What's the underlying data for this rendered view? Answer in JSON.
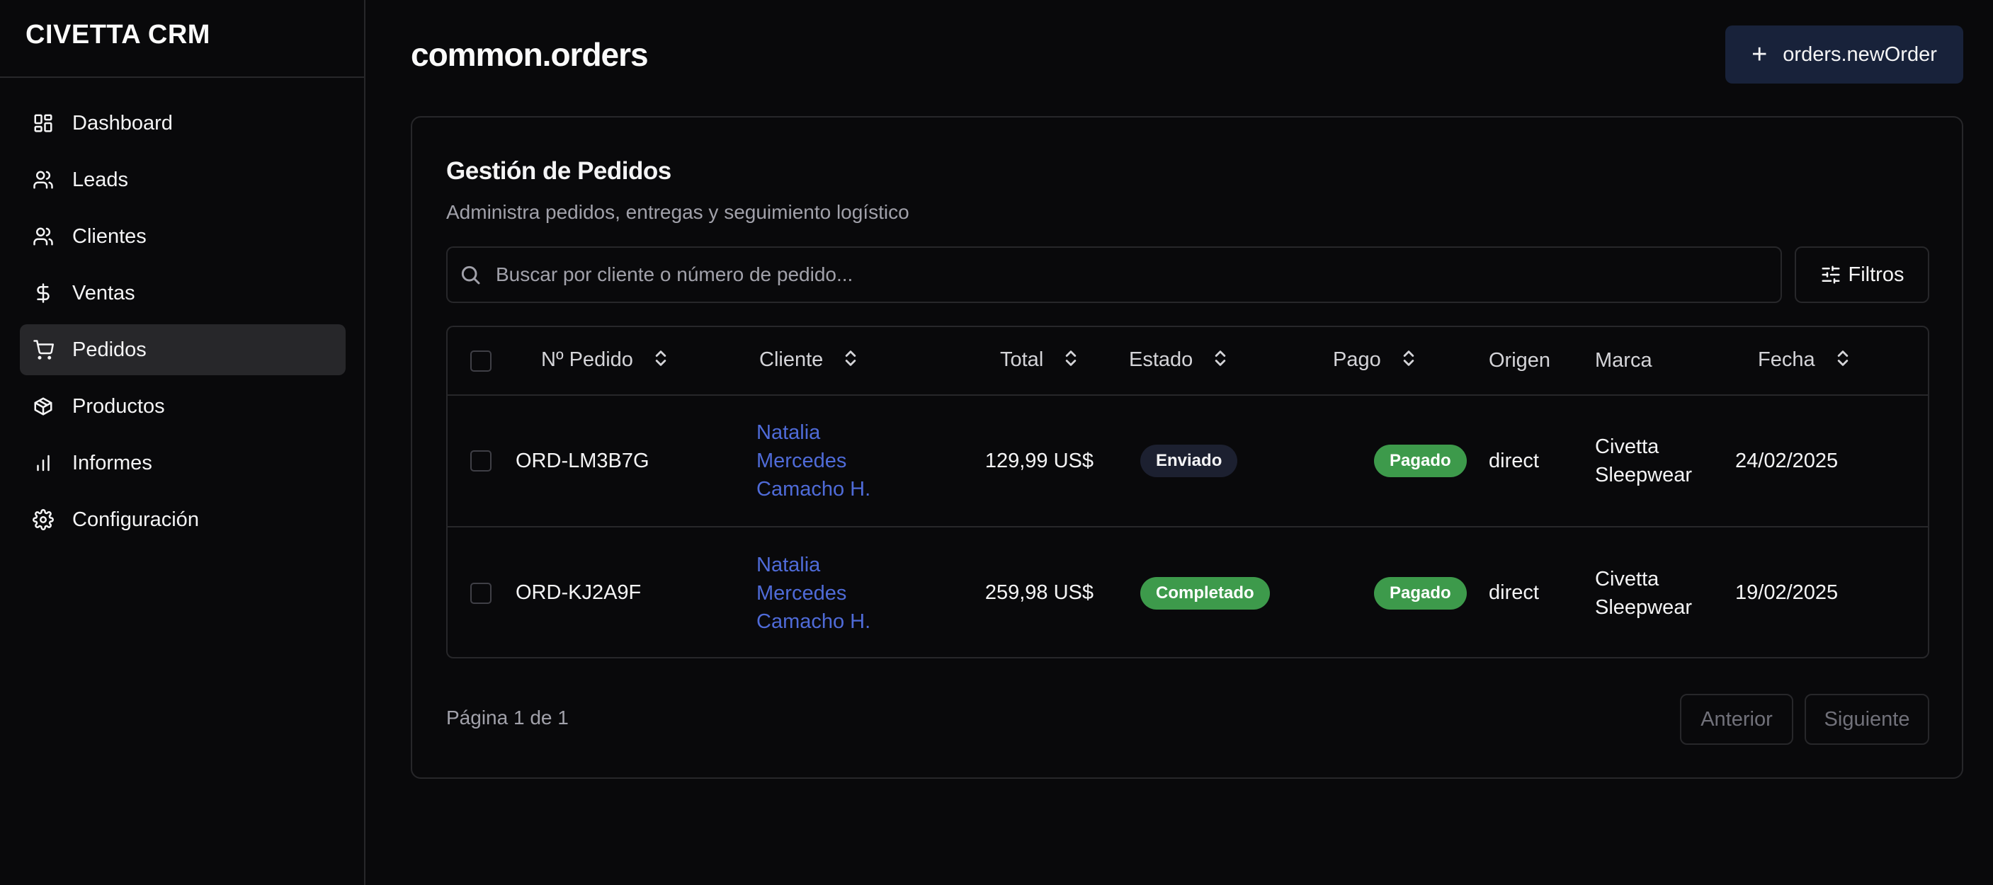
{
  "app": {
    "brand": "CIVETTA CRM"
  },
  "sidebar": {
    "items": [
      {
        "label": "Dashboard",
        "icon": "layout-dashboard-icon",
        "active": false
      },
      {
        "label": "Leads",
        "icon": "user-icon",
        "active": false
      },
      {
        "label": "Clientes",
        "icon": "users-icon",
        "active": false
      },
      {
        "label": "Ventas",
        "icon": "dollar-sign-icon",
        "active": false
      },
      {
        "label": "Pedidos",
        "icon": "shopping-cart-icon",
        "active": true
      },
      {
        "label": "Productos",
        "icon": "package-icon",
        "active": false
      },
      {
        "label": "Informes",
        "icon": "bar-chart-icon",
        "active": false
      },
      {
        "label": "Configuración",
        "icon": "settings-icon",
        "active": false
      }
    ]
  },
  "header": {
    "title": "common.orders",
    "new_order_label": "orders.newOrder"
  },
  "card": {
    "title": "Gestión de Pedidos",
    "subtitle": "Administra pedidos, entregas y seguimiento logístico",
    "search_placeholder": "Buscar por cliente o número de pedido...",
    "filters_label": "Filtros"
  },
  "table": {
    "columns": [
      "Nº Pedido",
      "Cliente",
      "Total",
      "Estado",
      "Pago",
      "Origen",
      "Marca",
      "Fecha"
    ],
    "rows": [
      {
        "order": "ORD-LM3B7G",
        "client": "Natalia Mercedes Camacho H.",
        "total": "129,99 US$",
        "status": "Enviado",
        "payment": "Pagado",
        "origin": "direct",
        "brand": "Civetta Sleepwear",
        "date": "24/02/2025"
      },
      {
        "order": "ORD-KJ2A9F",
        "client": "Natalia Mercedes Camacho H.",
        "total": "259,98 US$",
        "status": "Completado",
        "payment": "Pagado",
        "origin": "direct",
        "brand": "Civetta Sleepwear",
        "date": "19/02/2025"
      }
    ]
  },
  "pagination": {
    "info": "Página 1 de 1",
    "prev_label": "Anterior",
    "next_label": "Siguiente"
  },
  "colors": {
    "background": "#09090b",
    "border": "#27272a",
    "link": "#4f6bd8",
    "success": "#3d9a4b",
    "primary_button": "#18223a"
  }
}
